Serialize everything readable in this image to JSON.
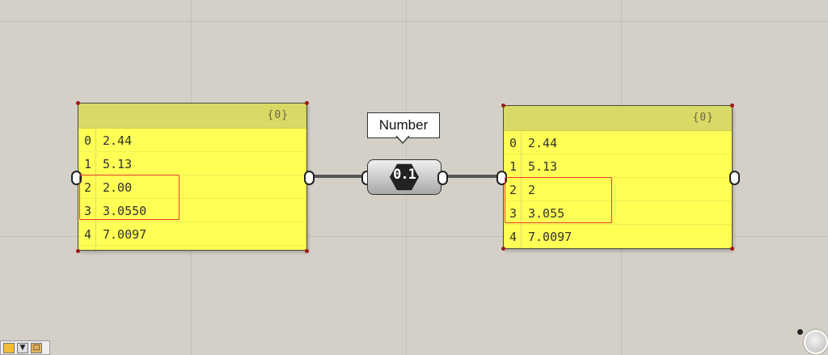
{
  "left_panel": {
    "path_label": "{0}",
    "rows": [
      {
        "index": "0",
        "value": "2.44"
      },
      {
        "index": "1",
        "value": "5.13"
      },
      {
        "index": "2",
        "value": "2.00"
      },
      {
        "index": "3",
        "value": "3.0550"
      },
      {
        "index": "4",
        "value": "7.0097"
      }
    ]
  },
  "number_component": {
    "icon_label": "0.1",
    "tooltip": "Number"
  },
  "right_panel": {
    "path_label": "{0}",
    "rows": [
      {
        "index": "0",
        "value": "2.44"
      },
      {
        "index": "1",
        "value": "5.13"
      },
      {
        "index": "2",
        "value": "2"
      },
      {
        "index": "3",
        "value": "3.055"
      },
      {
        "index": "4",
        "value": "7.0097"
      }
    ]
  },
  "taskbar": {
    "icons": [
      "app-icon",
      "download-icon",
      "window-icon"
    ]
  },
  "colors": {
    "canvas": "#d4d0c8",
    "panel": "#ffff55",
    "highlight": "#e04030",
    "wire": "#555555"
  }
}
